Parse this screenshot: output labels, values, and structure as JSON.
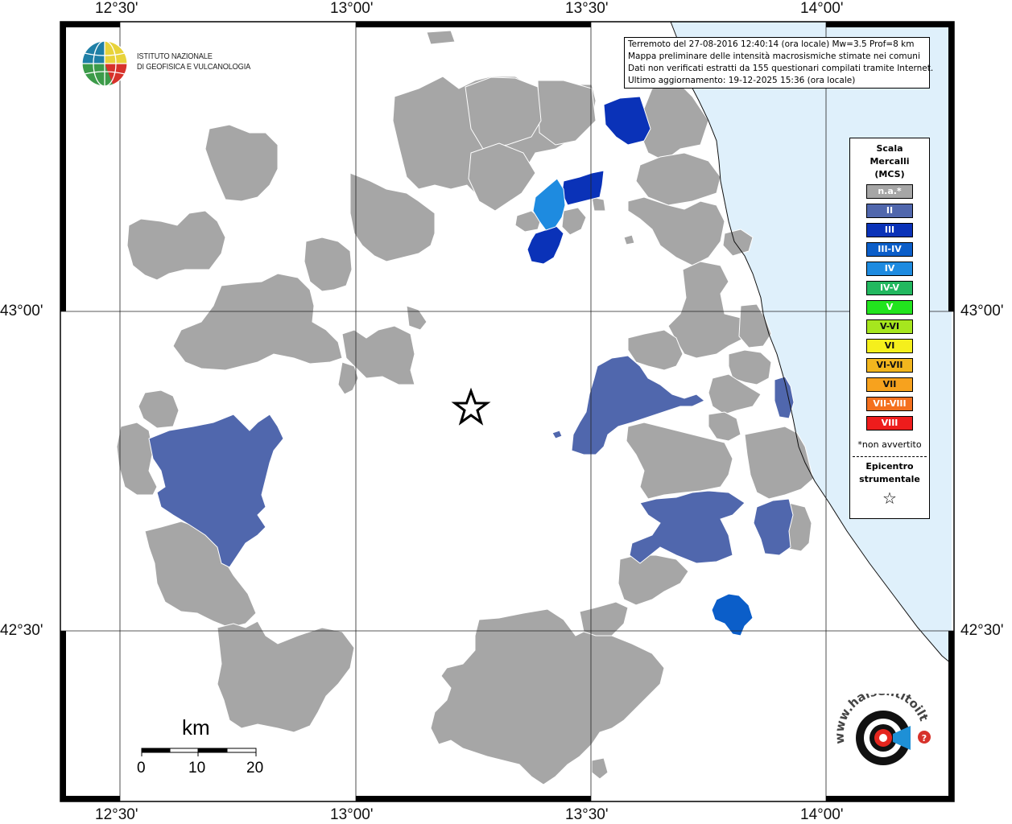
{
  "map": {
    "lon_labels": [
      "12°30'",
      "13°00'",
      "13°30'",
      "14°00'"
    ],
    "lat_labels": [
      "43°00'",
      "42°30'"
    ],
    "colors": {
      "land_na": "#a6a6a6",
      "sea": "#dff0fb",
      "intensity_II": "#5067ad",
      "intensity_III": "#0a32b8",
      "intensity_III_IV": "#0b5ec9",
      "intensity_IV": "#1e8be0"
    },
    "epicenter_symbol": "star-icon"
  },
  "infobox": {
    "line1": "Terremoto del 27-08-2016 12:40:14 (ora locale) Mw=3.5 Prof=8 km",
    "line2": "Mappa preliminare delle intensità macrosismiche stimate nei comuni",
    "line3": "Dati non verificati estratti da 155 questionari compilati tramite Internet.",
    "line4": "Ultimo aggiornamento: 19-12-2025 15:36 (ora locale)"
  },
  "legend": {
    "title": [
      "Scala",
      "Mercalli",
      "(MCS)"
    ],
    "items": [
      {
        "label": "n.a.*",
        "color": "#a6a6a6"
      },
      {
        "label": "II",
        "color": "#5067ad"
      },
      {
        "label": "III",
        "color": "#0a32b8"
      },
      {
        "label": "III-IV",
        "color": "#0b5ec9"
      },
      {
        "label": "IV",
        "color": "#1e8be0"
      },
      {
        "label": "IV-V",
        "color": "#22b85f"
      },
      {
        "label": "V",
        "color": "#22e41e"
      },
      {
        "label": "V-VI",
        "color": "#a6e61e"
      },
      {
        "label": "VI",
        "color": "#f5ef1c"
      },
      {
        "label": "VI-VII",
        "color": "#f2b61e"
      },
      {
        "label": "VII",
        "color": "#f7a21e"
      },
      {
        "label": "VII-VIII",
        "color": "#f4701e"
      },
      {
        "label": "VIII",
        "color": "#ee1c1c"
      }
    ],
    "note": "*non avvertito",
    "epicenter": [
      "Epicentro",
      "strumentale"
    ]
  },
  "logo": {
    "line1": "ISTITUTO NAZIONALE",
    "line2": "DI GEOFISICA E VULCANOLOGIA"
  },
  "scale_bar": {
    "unit": "km",
    "ticks": [
      "0",
      "10",
      "20"
    ]
  },
  "hsi_logo": {
    "text": "www.haisentitoilterremoto.it"
  }
}
